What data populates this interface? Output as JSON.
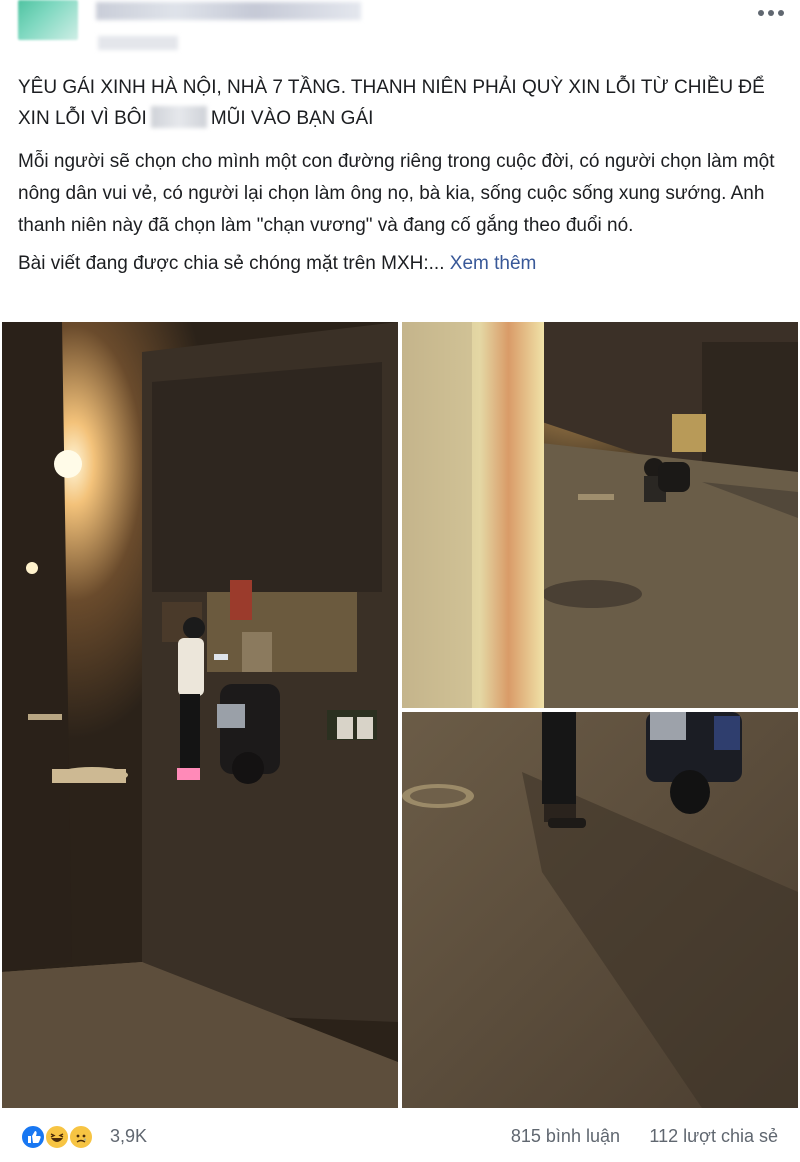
{
  "post": {
    "headline": "YÊU GÁI XINH HÀ NỘI, NHÀ 7 TẦNG. THANH NIÊN PHẢI QUỲ XIN LỖI TỪ CHIỀU ĐỂ XIN LỖI VÌ BÔI",
    "headline_tail": "MŨI VÀO BẠN GÁI",
    "paragraph": "Mỗi người sẽ chọn cho mình một con đường riêng trong cuộc đời, có người chọn làm một nông dân vui vẻ, có người lại chọn làm ông nọ, bà kia, sống cuộc sống xung sướng. Anh thanh niên này đã chọn làm \"chạn vương\" và đang cố gắng theo đuổi nó.",
    "teaser": "Bài viết đang được chia sẻ chóng mặt trên MXH:...",
    "see_more": "Xem thêm"
  },
  "header": {
    "more_icon": "more-horizontal-icon"
  },
  "reactions": {
    "icons": [
      "like-icon",
      "haha-icon",
      "sad-icon"
    ],
    "count": "3,9K",
    "comments": "815 bình luận",
    "shares": "112 lượt chia sẻ",
    "colors": {
      "like": "#1877f2",
      "haha": "#f7c443",
      "sad": "#f7c443",
      "meta_text": "#606770",
      "link": "#385898"
    }
  }
}
